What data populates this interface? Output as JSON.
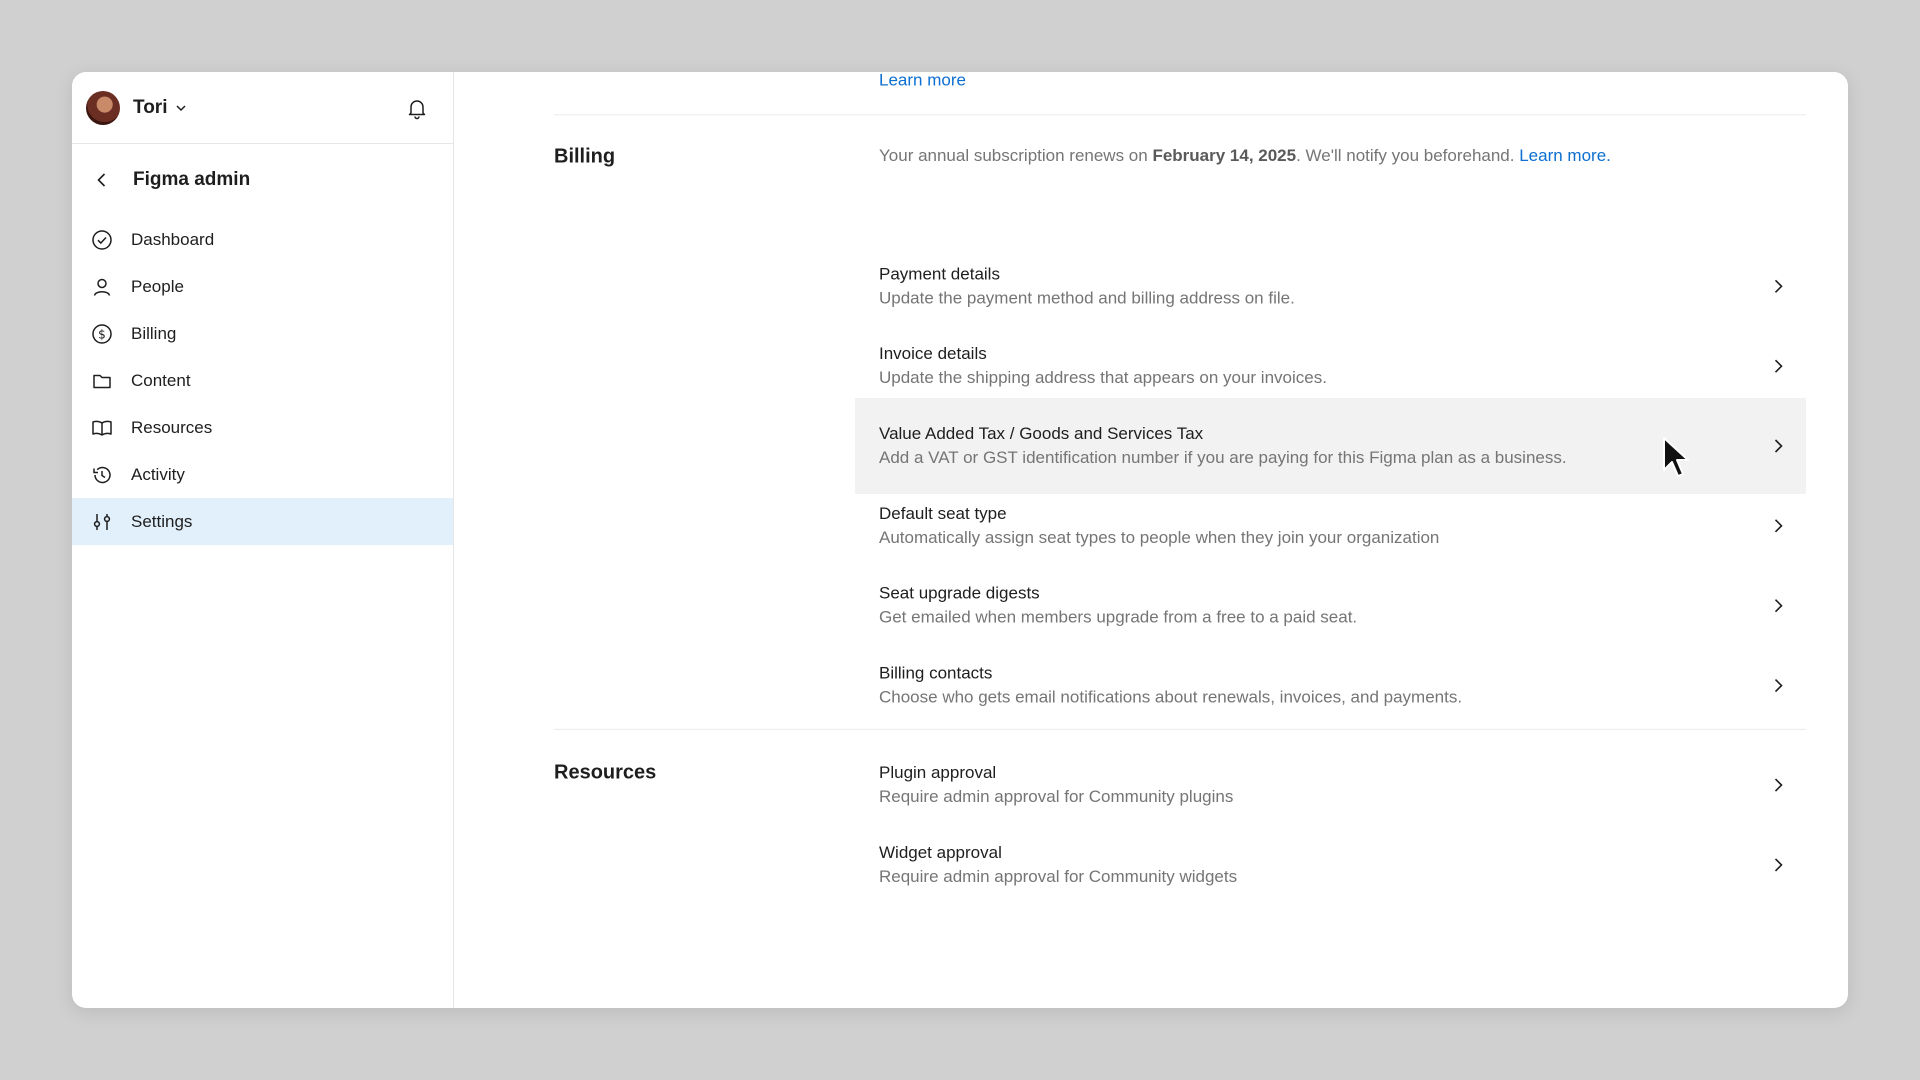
{
  "user": {
    "name": "Tori"
  },
  "sidebar": {
    "title": "Figma admin",
    "items": [
      {
        "label": "Dashboard",
        "icon": "check-circle-icon"
      },
      {
        "label": "People",
        "icon": "person-icon"
      },
      {
        "label": "Billing",
        "icon": "dollar-circle-icon"
      },
      {
        "label": "Content",
        "icon": "folder-icon"
      },
      {
        "label": "Resources",
        "icon": "book-icon"
      },
      {
        "label": "Activity",
        "icon": "history-icon"
      },
      {
        "label": "Settings",
        "icon": "sliders-icon",
        "active": true
      }
    ]
  },
  "main": {
    "top_link": "Learn more",
    "billing": {
      "label": "Billing",
      "note_prefix": "Your annual subscription renews on ",
      "note_date": "February 14, 2025",
      "note_suffix": ". We'll notify you beforehand. ",
      "note_link": "Learn more.",
      "rows": [
        {
          "title": "Payment details",
          "desc": "Update the payment method and billing address on file."
        },
        {
          "title": "Invoice details",
          "desc": "Update the shipping address that appears on your invoices."
        },
        {
          "title": "Value Added Tax / Goods and Services Tax",
          "desc": "Add a VAT or GST identification number if you are paying for this Figma plan as a business."
        },
        {
          "title": "Default seat type",
          "desc": "Automatically assign seat types to people when they join your organization"
        },
        {
          "title": "Seat upgrade digests",
          "desc": "Get emailed when members upgrade from a free to a paid seat."
        },
        {
          "title": "Billing contacts",
          "desc": "Choose who gets email notifications about renewals, invoices, and payments."
        }
      ]
    },
    "resources": {
      "label": "Resources",
      "rows": [
        {
          "title": "Plugin approval",
          "desc": "Require admin approval for Community plugins"
        },
        {
          "title": "Widget approval",
          "desc": "Require admin approval for Community widgets"
        }
      ]
    }
  },
  "colors": {
    "accent": "#0d6fd1",
    "active_bg": "#e2f0fb",
    "hover_bg": "#f2f2f2"
  }
}
